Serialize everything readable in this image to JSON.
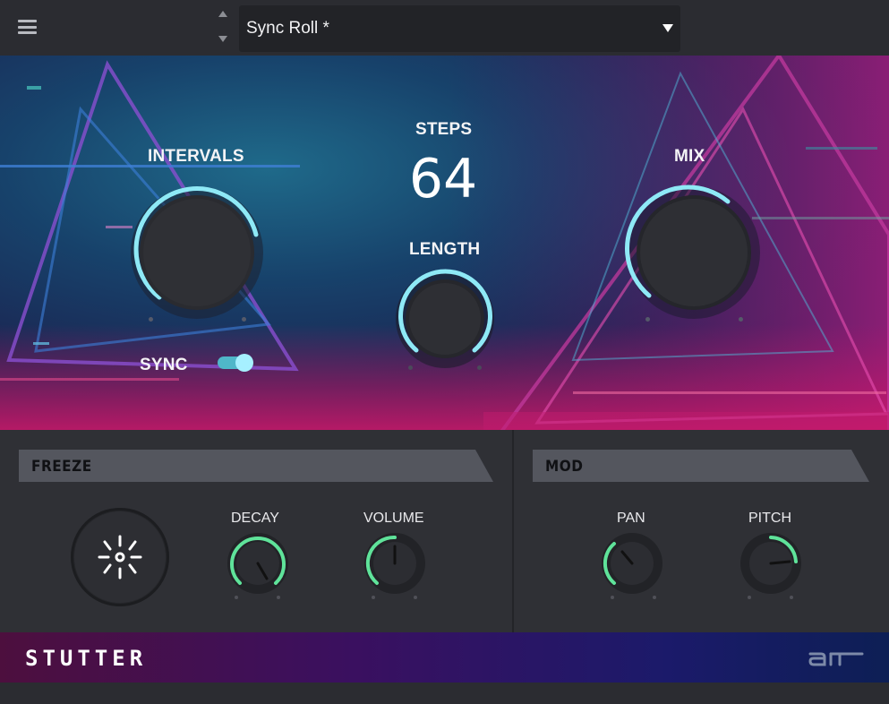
{
  "header": {
    "menu_icon": "hamburger-menu-icon",
    "preset_name": "Sync Roll *",
    "prev_icon": "arrow-up-icon",
    "next_icon": "arrow-down-icon",
    "dropdown_icon": "caret-down-icon"
  },
  "main": {
    "intervals_label": "INTERVALS",
    "steps_label": "STEPS",
    "steps_value": "64",
    "length_label": "LENGTH",
    "mix_label": "MIX",
    "sync_label": "SYNC",
    "sync_on": true
  },
  "freeze": {
    "title": "FREEZE",
    "button_icon": "freeze-burst-icon",
    "decay_label": "DECAY",
    "volume_label": "VOLUME"
  },
  "mod": {
    "title": "MOD",
    "pan_label": "PAN",
    "pitch_label": "PITCH"
  },
  "footer": {
    "plugin_name": "STUTTER",
    "logo": "air-logo"
  },
  "colors": {
    "accent_cyan": "#8ee9f6",
    "accent_green": "#5fe39a",
    "panel": "#2f3035",
    "section_bar": "#54565e"
  }
}
